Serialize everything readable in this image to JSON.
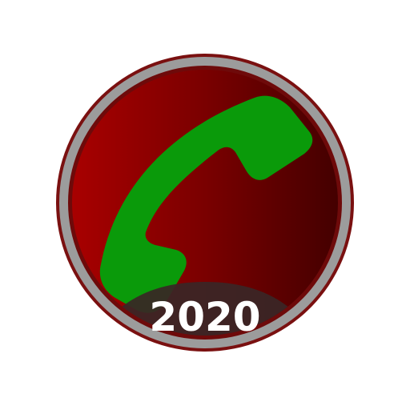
{
  "app_icon": {
    "name": "call-recorder-icon",
    "year_badge": "2020",
    "colors": {
      "background": "#ffffff",
      "ring_outer": "#8b1a1a",
      "ring_gray": "#9a9a9a",
      "disc_light": "#a30000",
      "disc_dark": "#4a0000",
      "handset": "#0a9a0a",
      "badge_band": "#3c2a2a",
      "badge_text": "#ffffff"
    },
    "icons": [
      "phone-handset-icon"
    ]
  }
}
